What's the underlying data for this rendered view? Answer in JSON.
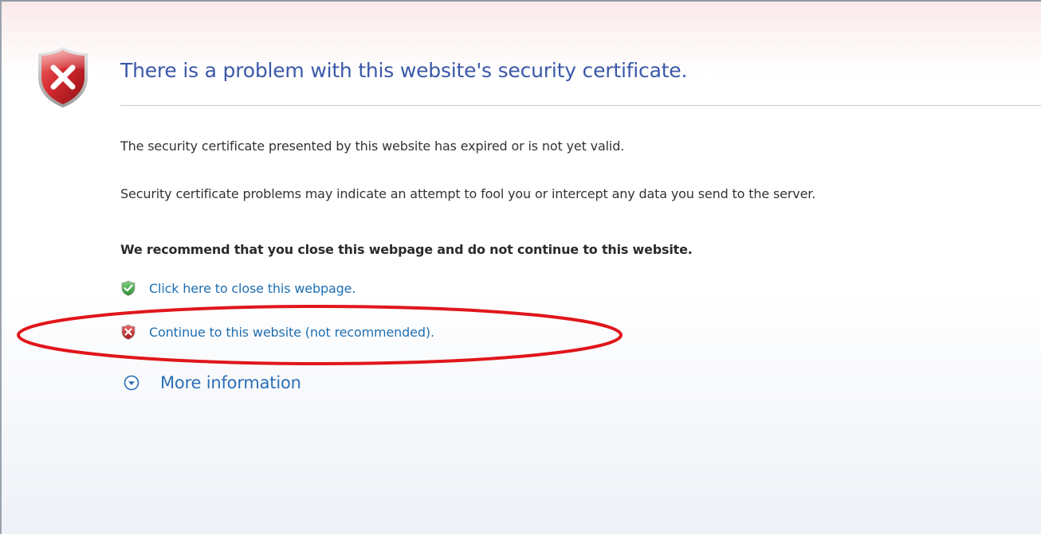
{
  "error_page": {
    "title": "There is a problem with this website's security certificate.",
    "message_expired": "The security certificate presented by this website has expired or is not yet valid.",
    "message_risk": "Security certificate problems may indicate an attempt to fool you or intercept any data you send to the server.",
    "recommendation": "We recommend that you close this webpage and do not continue to this website.",
    "close_link": "Click here to close this webpage.",
    "continue_link": "Continue to this website (not recommended).",
    "more_info": "More information"
  },
  "icons": {
    "main": "error-shield-icon",
    "close": "green-check-shield-icon",
    "continue": "red-x-shield-icon",
    "more": "expand-chevron-circle-icon"
  },
  "colors": {
    "title": "#3a58a8",
    "link": "#1f6fb0",
    "body_text": "#333333",
    "shield_red": "#c8242b",
    "shield_green": "#3aa33a",
    "annotation": "#e0161b"
  }
}
